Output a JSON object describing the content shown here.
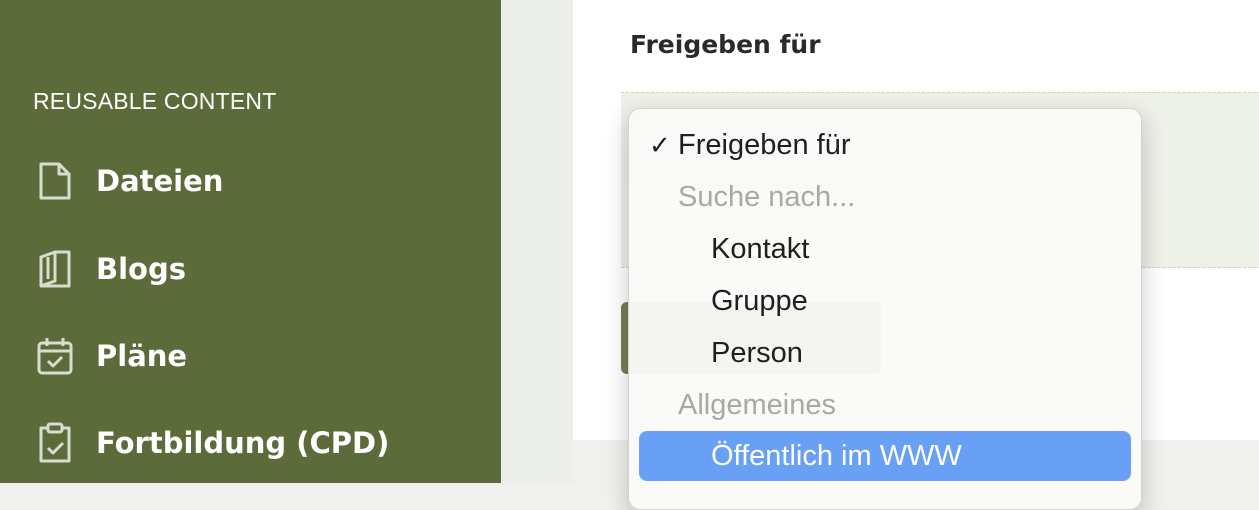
{
  "sidebar": {
    "section_heading": "REUSABLE CONTENT",
    "items": [
      {
        "label": "Dateien",
        "icon": "file-icon"
      },
      {
        "label": "Blogs",
        "icon": "book-icon"
      },
      {
        "label": "Pläne",
        "icon": "calendar-check-icon"
      },
      {
        "label": "Fortbildung (CPD)",
        "icon": "clipboard-check-icon"
      }
    ]
  },
  "main": {
    "share_label": "Freigeben für"
  },
  "dropdown": {
    "selected_check": "✓",
    "options": [
      {
        "label": "Freigeben für",
        "selected": true
      },
      {
        "label": "Suche nach...",
        "disabled": true
      },
      {
        "label": "Kontakt"
      },
      {
        "label": "Gruppe"
      },
      {
        "label": "Person"
      },
      {
        "label": "Allgemeines",
        "disabled": true
      },
      {
        "label": "Öffentlich im WWW",
        "highlighted": true
      }
    ]
  },
  "colors": {
    "sidebar_bg": "#5b6b3a",
    "highlight": "#68a0f5"
  }
}
